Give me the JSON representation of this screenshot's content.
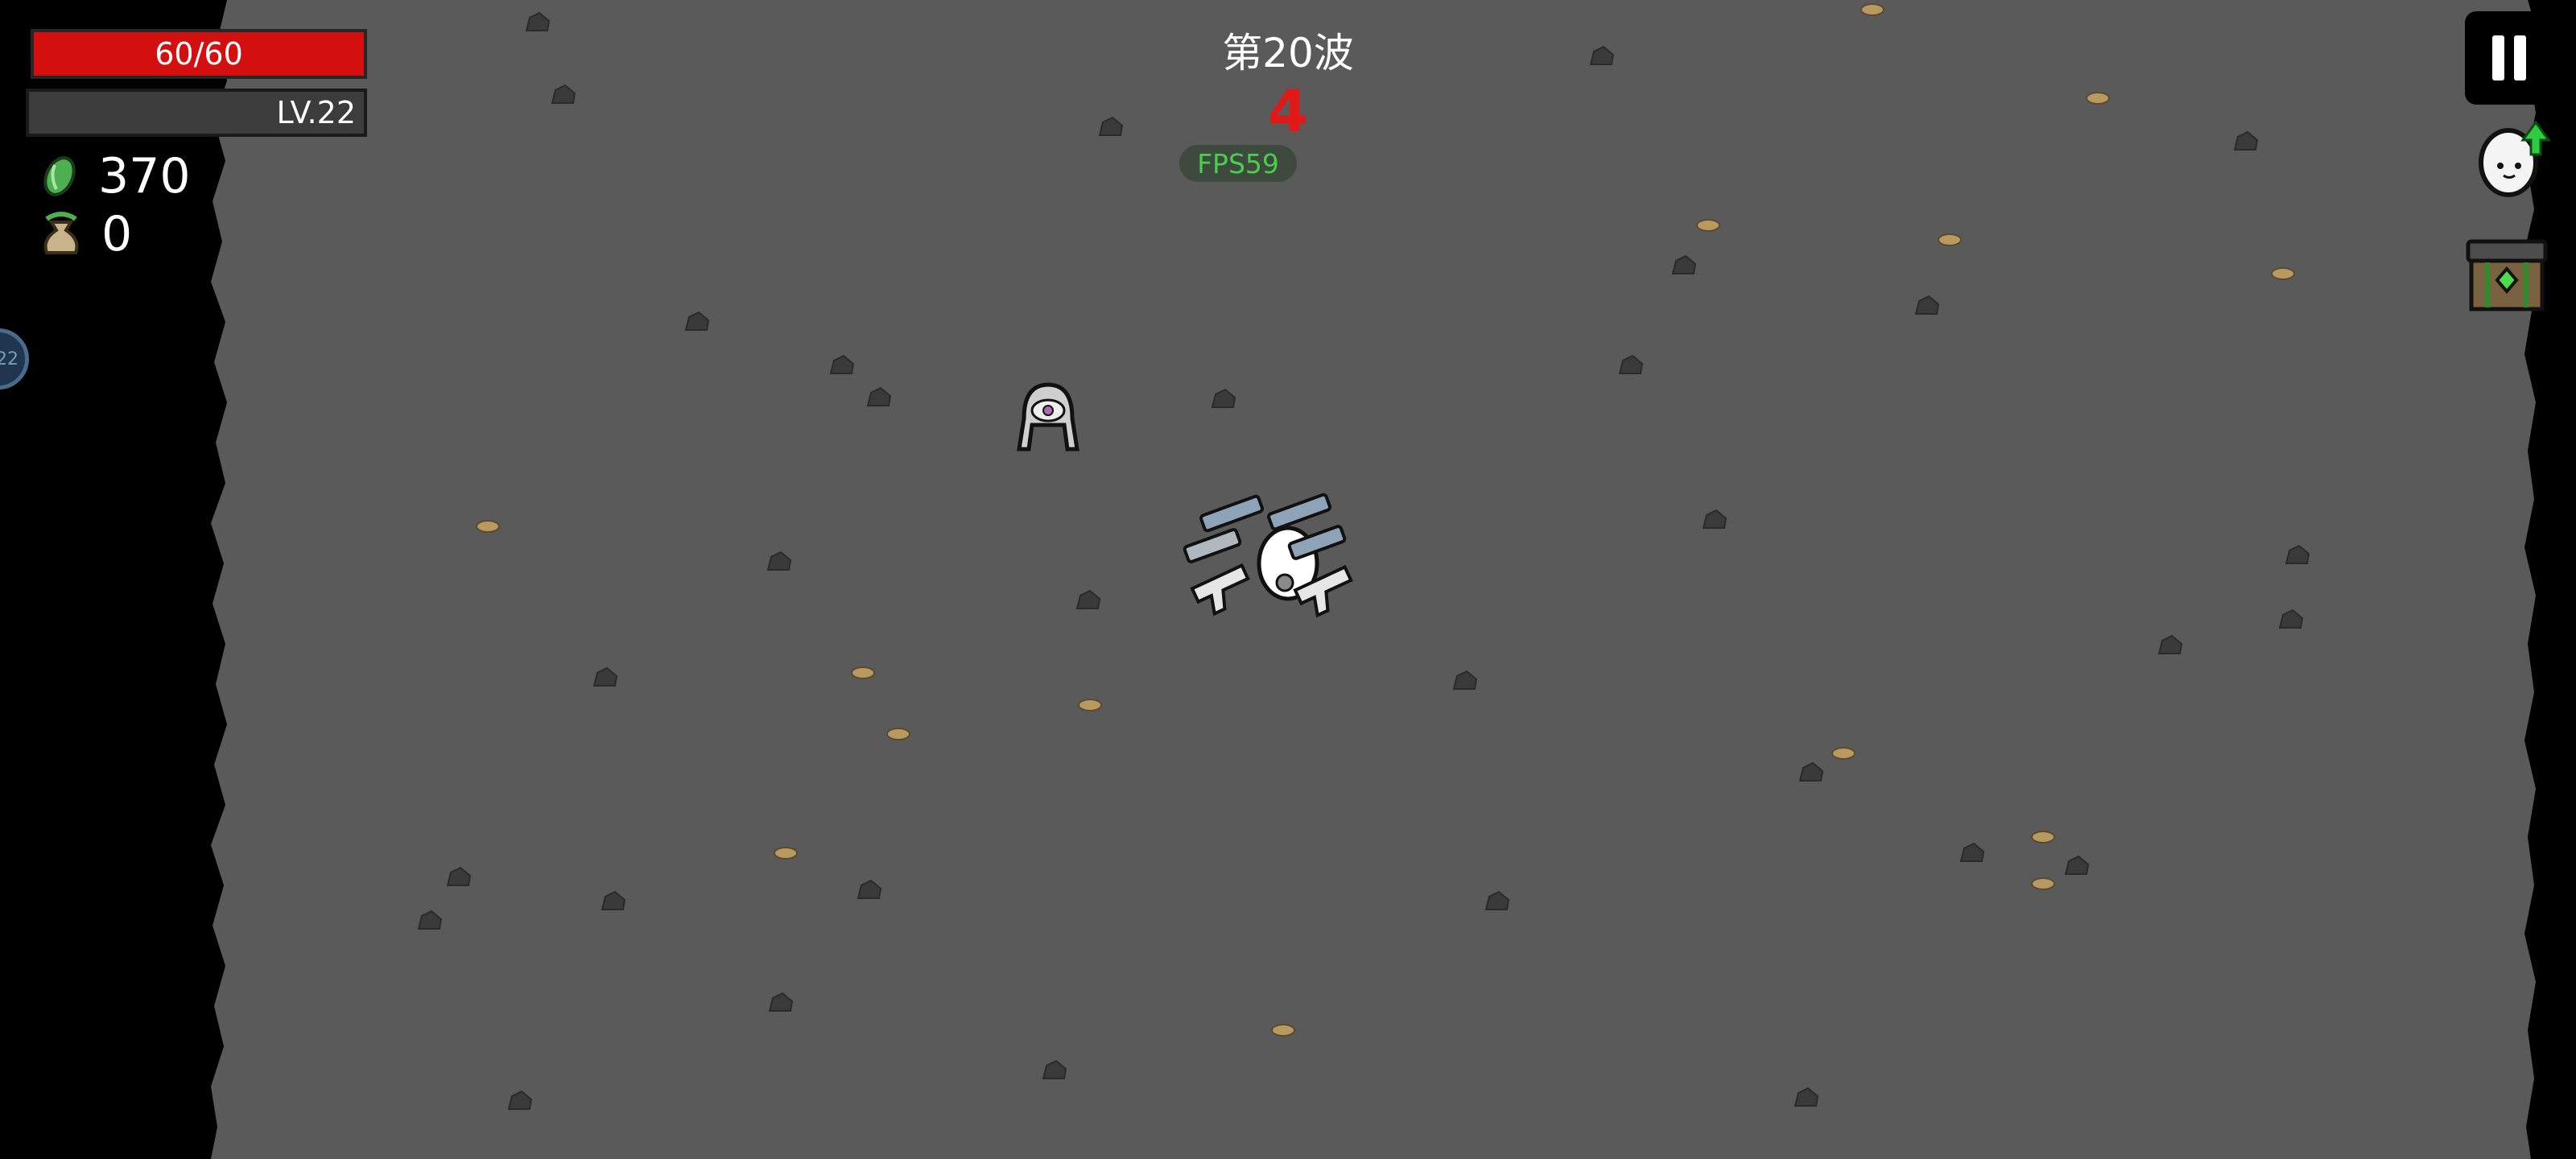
{
  "hud": {
    "health": {
      "text": "60/60",
      "current": 60,
      "max": 60,
      "fill_color": "#d40f0f"
    },
    "level": {
      "text": "LV.22",
      "xp_fraction": 0.0
    },
    "materials": {
      "icon": "green-gem-icon",
      "value": "370"
    },
    "bags": {
      "icon": "money-bag-icon",
      "value": "0"
    },
    "side_badge": {
      "text": "22"
    }
  },
  "wave": {
    "label": "第20波",
    "countdown": "4"
  },
  "fps": {
    "label": "FPS59"
  },
  "right_panel": {
    "pause_icon": "pause-icon",
    "egg_icon": "egg-levelup-icon",
    "crate_icon": "loot-crate-icon",
    "levelup_arrow_color": "#2ecc40"
  },
  "colors": {
    "ground": "#5a5a5a",
    "rock": "#3a3a3a",
    "pebble": "#b89a60",
    "border": "#000000"
  }
}
